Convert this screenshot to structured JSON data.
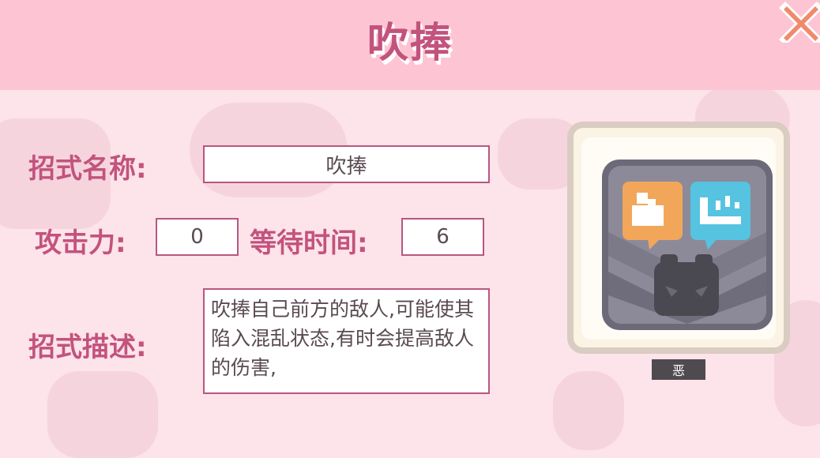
{
  "header": {
    "title": "吹捧"
  },
  "labels": {
    "move_name": "招式名称:",
    "attack": "攻击力:",
    "wait_time": "等待时间:",
    "description": "招式描述:"
  },
  "move": {
    "name": "吹捧",
    "attack": "0",
    "wait_time": "6",
    "description": "吹捧自己前方的敌人,可能使其陷入混乱状态,有时会提高敌人的伤害,"
  },
  "card": {
    "type": "恶",
    "icon": "dark-type-move-icon"
  },
  "colors": {
    "accent": "#c2537d",
    "header_bg": "#fdc5d3",
    "page_bg": "#fde3ea",
    "close": "#f08a6b"
  }
}
